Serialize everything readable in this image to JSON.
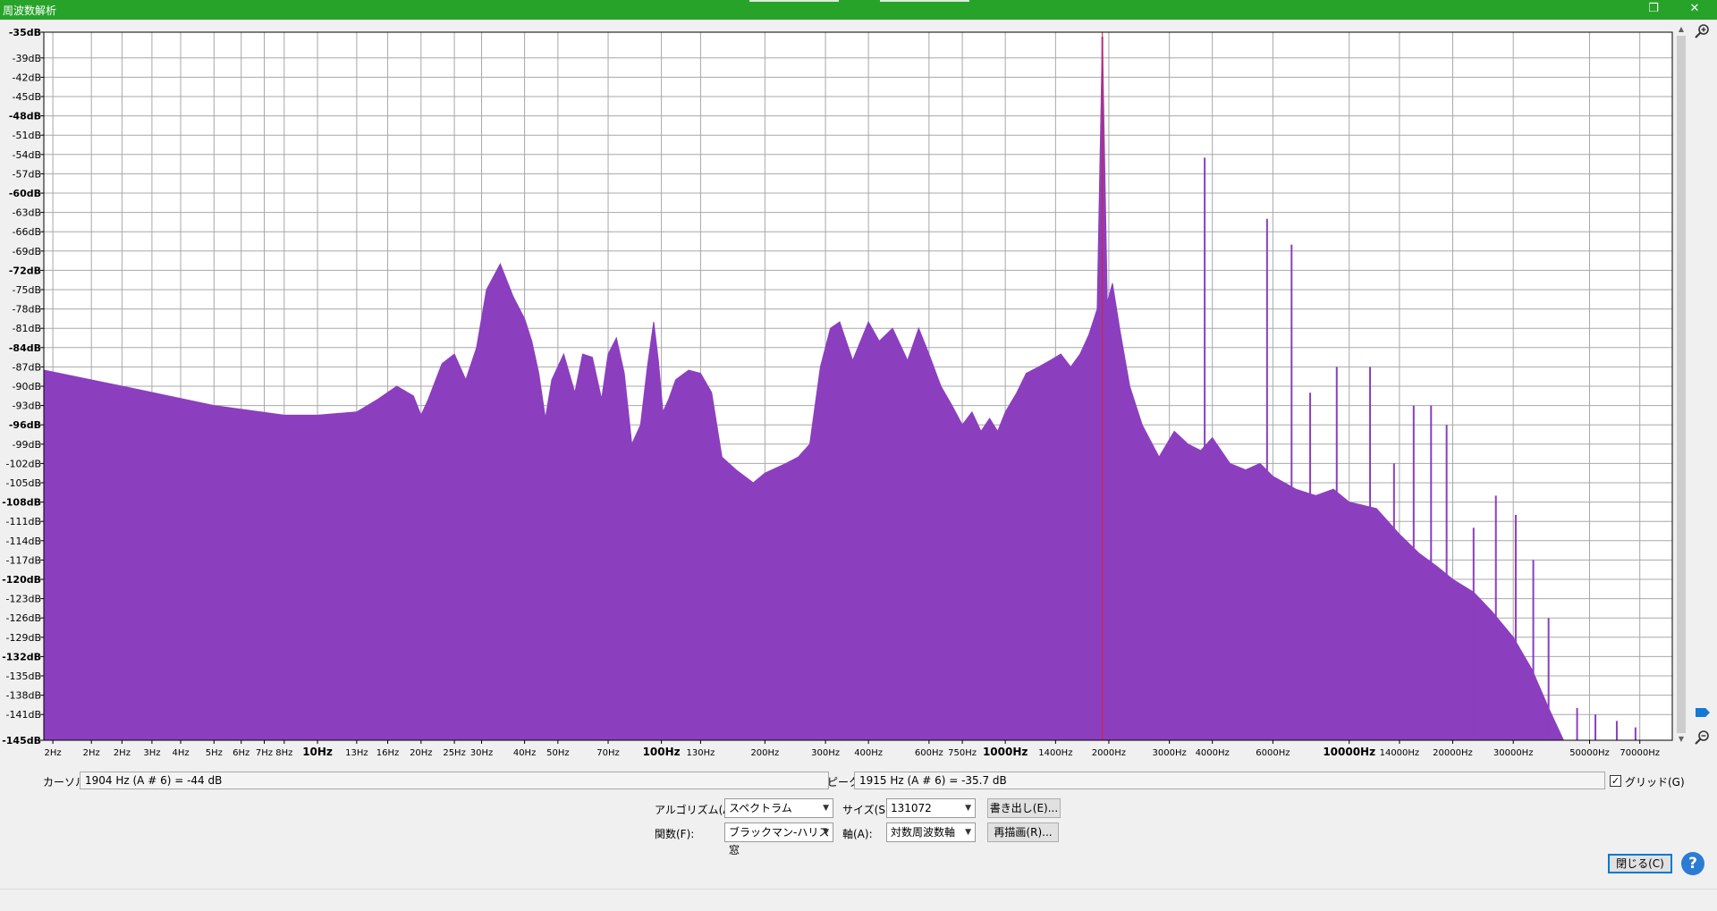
{
  "window": {
    "title": "周波数解析",
    "buttons": {
      "restore": "❐",
      "close": "✕"
    }
  },
  "spectrum": {
    "fill_color": "#8b3fbf",
    "grid_color": "#a8a8a8",
    "peak_line_color": "#e0202a",
    "freq_scale": "log",
    "db_range": [
      -145,
      -35
    ],
    "freq_range": [
      1.6,
      87000
    ],
    "peak_marker_hz": 1915,
    "y_ticks": [
      {
        "db": -35,
        "label": "-35dB",
        "bold": true
      },
      {
        "db": -39,
        "label": "-39dB",
        "bold": false
      },
      {
        "db": -42,
        "label": "-42dB",
        "bold": false
      },
      {
        "db": -45,
        "label": "-45dB",
        "bold": false
      },
      {
        "db": -48,
        "label": "-48dB",
        "bold": true
      },
      {
        "db": -51,
        "label": "-51dB",
        "bold": false
      },
      {
        "db": -54,
        "label": "-54dB",
        "bold": false
      },
      {
        "db": -57,
        "label": "-57dB",
        "bold": false
      },
      {
        "db": -60,
        "label": "-60dB",
        "bold": true
      },
      {
        "db": -63,
        "label": "-63dB",
        "bold": false
      },
      {
        "db": -66,
        "label": "-66dB",
        "bold": false
      },
      {
        "db": -69,
        "label": "-69dB",
        "bold": false
      },
      {
        "db": -72,
        "label": "-72dB",
        "bold": true
      },
      {
        "db": -75,
        "label": "-75dB",
        "bold": false
      },
      {
        "db": -78,
        "label": "-78dB",
        "bold": false
      },
      {
        "db": -81,
        "label": "-81dB",
        "bold": false
      },
      {
        "db": -84,
        "label": "-84dB",
        "bold": true
      },
      {
        "db": -87,
        "label": "-87dB",
        "bold": false
      },
      {
        "db": -90,
        "label": "-90dB",
        "bold": false
      },
      {
        "db": -93,
        "label": "-93dB",
        "bold": false
      },
      {
        "db": -96,
        "label": "-96dB",
        "bold": true
      },
      {
        "db": -99,
        "label": "-99dB",
        "bold": false
      },
      {
        "db": -102,
        "label": "-102dB",
        "bold": false
      },
      {
        "db": -105,
        "label": "-105dB",
        "bold": false
      },
      {
        "db": -108,
        "label": "-108dB",
        "bold": true
      },
      {
        "db": -111,
        "label": "-111dB",
        "bold": false
      },
      {
        "db": -114,
        "label": "-114dB",
        "bold": false
      },
      {
        "db": -117,
        "label": "-117dB",
        "bold": false
      },
      {
        "db": -120,
        "label": "-120dB",
        "bold": true
      },
      {
        "db": -123,
        "label": "-123dB",
        "bold": false
      },
      {
        "db": -126,
        "label": "-126dB",
        "bold": false
      },
      {
        "db": -129,
        "label": "-129dB",
        "bold": false
      },
      {
        "db": -132,
        "label": "-132dB",
        "bold": true
      },
      {
        "db": -135,
        "label": "-135dB",
        "bold": false
      },
      {
        "db": -138,
        "label": "-138dB",
        "bold": false
      },
      {
        "db": -141,
        "label": "-141dB",
        "bold": false
      },
      {
        "db": -145,
        "label": "-145dB",
        "bold": true
      }
    ],
    "x_ticks": [
      {
        "hz": 1.7,
        "label": "2Hz",
        "bold": false
      },
      {
        "hz": 2.2,
        "label": "2Hz",
        "bold": false
      },
      {
        "hz": 2.7,
        "label": "2Hz",
        "bold": false
      },
      {
        "hz": 3.3,
        "label": "3Hz",
        "bold": false
      },
      {
        "hz": 4,
        "label": "4Hz",
        "bold": false
      },
      {
        "hz": 5,
        "label": "5Hz",
        "bold": false
      },
      {
        "hz": 6,
        "label": "6Hz",
        "bold": false
      },
      {
        "hz": 7,
        "label": "7Hz",
        "bold": false
      },
      {
        "hz": 8,
        "label": "8Hz",
        "bold": false
      },
      {
        "hz": 10,
        "label": "10Hz",
        "bold": true
      },
      {
        "hz": 13,
        "label": "13Hz",
        "bold": false
      },
      {
        "hz": 16,
        "label": "16Hz",
        "bold": false
      },
      {
        "hz": 20,
        "label": "20Hz",
        "bold": false
      },
      {
        "hz": 25,
        "label": "25Hz",
        "bold": false
      },
      {
        "hz": 30,
        "label": "30Hz",
        "bold": false
      },
      {
        "hz": 40,
        "label": "40Hz",
        "bold": false
      },
      {
        "hz": 50,
        "label": "50Hz",
        "bold": false
      },
      {
        "hz": 70,
        "label": "70Hz",
        "bold": false
      },
      {
        "hz": 100,
        "label": "100Hz",
        "bold": true
      },
      {
        "hz": 130,
        "label": "130Hz",
        "bold": false
      },
      {
        "hz": 200,
        "label": "200Hz",
        "bold": false
      },
      {
        "hz": 300,
        "label": "300Hz",
        "bold": false
      },
      {
        "hz": 400,
        "label": "400Hz",
        "bold": false
      },
      {
        "hz": 600,
        "label": "600Hz",
        "bold": false
      },
      {
        "hz": 750,
        "label": "750Hz",
        "bold": false
      },
      {
        "hz": 1000,
        "label": "1000Hz",
        "bold": true
      },
      {
        "hz": 1400,
        "label": "1400Hz",
        "bold": false
      },
      {
        "hz": 2000,
        "label": "2000Hz",
        "bold": false
      },
      {
        "hz": 3000,
        "label": "3000Hz",
        "bold": false
      },
      {
        "hz": 4000,
        "label": "4000Hz",
        "bold": false
      },
      {
        "hz": 6000,
        "label": "6000Hz",
        "bold": false
      },
      {
        "hz": 10000,
        "label": "10000Hz",
        "bold": true
      },
      {
        "hz": 14000,
        "label": "14000Hz",
        "bold": false
      },
      {
        "hz": 20000,
        "label": "20000Hz",
        "bold": false
      },
      {
        "hz": 30000,
        "label": "30000Hz",
        "bold": false
      },
      {
        "hz": 50000,
        "label": "50000Hz",
        "bold": false
      },
      {
        "hz": 70000,
        "label": "70000Hz",
        "bold": false
      }
    ],
    "envelope": [
      [
        1.6,
        -87.5
      ],
      [
        3,
        -90.5
      ],
      [
        5,
        -93
      ],
      [
        8,
        -94.5
      ],
      [
        10,
        -94.5
      ],
      [
        13,
        -94
      ],
      [
        15,
        -92
      ],
      [
        17,
        -90
      ],
      [
        19,
        -91.5
      ],
      [
        20,
        -94.5
      ],
      [
        21,
        -92
      ],
      [
        23,
        -86.5
      ],
      [
        25,
        -85
      ],
      [
        27,
        -89
      ],
      [
        29,
        -84
      ],
      [
        31,
        -75
      ],
      [
        34,
        -71
      ],
      [
        37,
        -76
      ],
      [
        40,
        -79.5
      ],
      [
        42,
        -83
      ],
      [
        44,
        -88
      ],
      [
        46,
        -95
      ],
      [
        48,
        -89
      ],
      [
        52,
        -85
      ],
      [
        56,
        -91
      ],
      [
        59,
        -85
      ],
      [
        63,
        -85.5
      ],
      [
        67,
        -92
      ],
      [
        70,
        -85
      ],
      [
        74,
        -82.5
      ],
      [
        78,
        -88
      ],
      [
        82,
        -99
      ],
      [
        87,
        -96
      ],
      [
        91,
        -87
      ],
      [
        95,
        -80
      ],
      [
        98,
        -86
      ],
      [
        101,
        -94
      ],
      [
        105,
        -92
      ],
      [
        110,
        -89
      ],
      [
        120,
        -87.5
      ],
      [
        130,
        -88
      ],
      [
        140,
        -91
      ],
      [
        150,
        -101
      ],
      [
        165,
        -103
      ],
      [
        185,
        -105
      ],
      [
        200,
        -103.5
      ],
      [
        230,
        -102
      ],
      [
        250,
        -101
      ],
      [
        270,
        -99
      ],
      [
        290,
        -87
      ],
      [
        310,
        -81
      ],
      [
        330,
        -80
      ],
      [
        360,
        -86
      ],
      [
        400,
        -80
      ],
      [
        430,
        -83
      ],
      [
        470,
        -81
      ],
      [
        520,
        -86
      ],
      [
        560,
        -81
      ],
      [
        600,
        -85
      ],
      [
        650,
        -90
      ],
      [
        700,
        -93
      ],
      [
        750,
        -96
      ],
      [
        800,
        -94
      ],
      [
        850,
        -97
      ],
      [
        900,
        -95
      ],
      [
        950,
        -97
      ],
      [
        1000,
        -94
      ],
      [
        1080,
        -91
      ],
      [
        1150,
        -88
      ],
      [
        1250,
        -87
      ],
      [
        1350,
        -86
      ],
      [
        1450,
        -85
      ],
      [
        1550,
        -87
      ],
      [
        1650,
        -85
      ],
      [
        1750,
        -82
      ],
      [
        1850,
        -78
      ],
      [
        1915,
        -35.7
      ],
      [
        1980,
        -77
      ],
      [
        2050,
        -74
      ],
      [
        2150,
        -81
      ],
      [
        2300,
        -90
      ],
      [
        2500,
        -96
      ],
      [
        2800,
        -101
      ],
      [
        3100,
        -97
      ],
      [
        3400,
        -99
      ],
      [
        3700,
        -100
      ],
      [
        4000,
        -98
      ],
      [
        4500,
        -102
      ],
      [
        5000,
        -103
      ],
      [
        5500,
        -102
      ],
      [
        6000,
        -104
      ],
      [
        7000,
        -106
      ],
      [
        8000,
        -107
      ],
      [
        9000,
        -106
      ],
      [
        10000,
        -108
      ],
      [
        12000,
        -109
      ],
      [
        14000,
        -113
      ],
      [
        16000,
        -116
      ],
      [
        18000,
        -118
      ],
      [
        20000,
        -120
      ],
      [
        23000,
        -122
      ],
      [
        26000,
        -125
      ],
      [
        30000,
        -129
      ],
      [
        34000,
        -134
      ],
      [
        38000,
        -140
      ],
      [
        42000,
        -145
      ]
    ],
    "peaks": [
      [
        1915,
        -35.7
      ],
      [
        3800,
        -54.5
      ],
      [
        5770,
        -64
      ],
      [
        6800,
        -68
      ],
      [
        7700,
        -91
      ],
      [
        9200,
        -87
      ],
      [
        11500,
        -87
      ],
      [
        13500,
        -102
      ],
      [
        15400,
        -93
      ],
      [
        17300,
        -93
      ],
      [
        19200,
        -96
      ],
      [
        23000,
        -112
      ],
      [
        26700,
        -107
      ],
      [
        30500,
        -110
      ],
      [
        34300,
        -117
      ],
      [
        38000,
        -126
      ],
      [
        46000,
        -140
      ],
      [
        52000,
        -141
      ],
      [
        60000,
        -142
      ],
      [
        68000,
        -143
      ]
    ]
  },
  "cursor": {
    "label": "カーソル:",
    "value": "1904 Hz (A # 6) = -44 dB"
  },
  "peak": {
    "label": "ピーク:",
    "value": "1915 Hz (A # 6) = -35.7 dB"
  },
  "grid": {
    "label": "グリッド(G)",
    "checked": "✓"
  },
  "controls": {
    "algorithm_label": "アルゴリズム(A):",
    "algorithm_value": "スペクトラム",
    "size_label": "サイズ(S):",
    "size_value": "131072",
    "export_button": "書き出し(E)...",
    "function_label": "関数(F):",
    "function_value": "ブラックマン-ハリス窓",
    "axis_label": "軸(A):",
    "axis_value": "対数周波数軸",
    "replot_button": "再描画(R)...",
    "close_button": "閉じる(C)",
    "help_button": "?"
  }
}
